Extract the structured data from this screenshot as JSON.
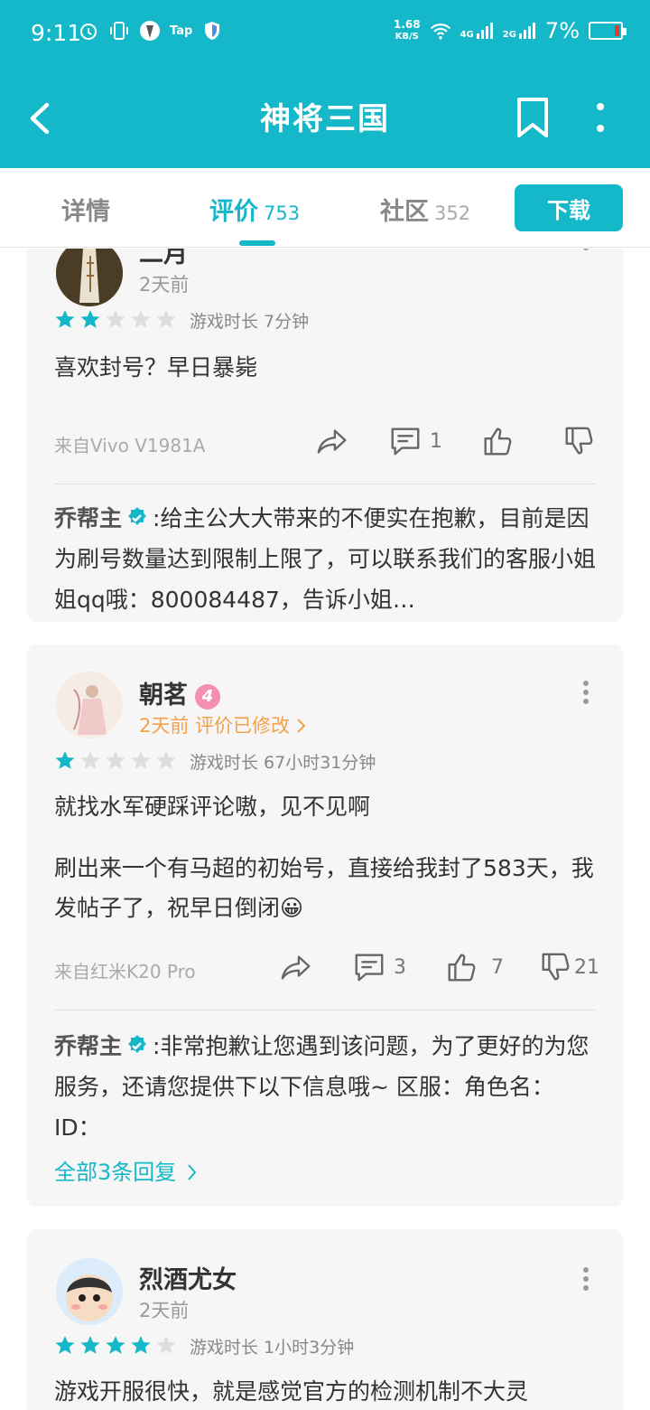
{
  "status_bar": {
    "time": "9:11",
    "tap_label": "Tap",
    "net_speed_value": "1.68",
    "net_speed_unit": "KB/S",
    "net_4g": "4G",
    "net_2g": "2G",
    "battery": "7%"
  },
  "app_bar": {
    "title": "神将三国"
  },
  "tabs": [
    {
      "label": "详情",
      "count": ""
    },
    {
      "label": "评价",
      "count": "753"
    },
    {
      "label": "社区",
      "count": "352"
    }
  ],
  "download_label": "下载",
  "reviews": [
    {
      "user": "二月",
      "time": "2天前",
      "rating": 2,
      "max_rating": 5,
      "playtime": "游戏时长 7分钟",
      "text": [
        "喜欢封号？早日暴毙"
      ],
      "device": "来自Vivo V1981A",
      "comments": "1",
      "likes": "",
      "dislikes": "",
      "reply": {
        "author": "乔帮主",
        "text": ":给主公大大带来的不便实在抱歉，目前是因为刷号数量达到限制上限了，可以联系我们的客服小姐姐qq哦：800084487，告诉小姐…"
      }
    },
    {
      "user": "朝茗",
      "level": "4",
      "time": "2天前",
      "edited": "评价已修改",
      "rating": 1,
      "max_rating": 5,
      "playtime": "游戏时长 67小时31分钟",
      "text": [
        "就找水军硬踩评论嗷，见不见啊",
        "刷出来一个有马超的初始号，直接给我封了583天，我发帖子了，祝早日倒闭😀"
      ],
      "device": "来自红米K20 Pro",
      "comments": "3",
      "likes": "7",
      "dislikes": "21",
      "reply": {
        "author": "乔帮主",
        "text": ":非常抱歉让您遇到该问题，为了更好的为您服务，还请您提供下以下信息哦~ 区服：角色名： ID："
      },
      "all_replies": "全部3条回复"
    },
    {
      "user": "烈酒尤女",
      "time": "2天前",
      "rating": 4,
      "max_rating": 5,
      "playtime": "游戏时长 1小时3分钟",
      "text": [
        "游戏开服很快，就是感觉官方的检测机制不大灵"
      ]
    }
  ],
  "colors": {
    "accent": "#15b8c8",
    "star_on": "#15b8c8",
    "star_off": "#dddddd",
    "orange": "#f5a04a"
  }
}
